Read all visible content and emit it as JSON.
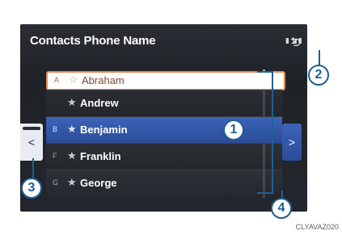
{
  "header": {
    "title": "Contacts Phone Name",
    "back_icon": "back-arrow-icon"
  },
  "status": {
    "glyphs": "▮◢▮"
  },
  "contacts": [
    {
      "index": "A",
      "name": "Abraham",
      "state": "selected"
    },
    {
      "index": "",
      "name": "Andrew",
      "state": "normal"
    },
    {
      "index": "B",
      "name": "Benjamin",
      "state": "highlight"
    },
    {
      "index": "F",
      "name": "Franklin",
      "state": "normal"
    },
    {
      "index": "G",
      "name": "George",
      "state": "normal"
    }
  ],
  "controls": {
    "left_tab": "<",
    "right_tab": ">"
  },
  "callouts": [
    "1",
    "2",
    "3",
    "4"
  ],
  "footer": {
    "code": "CLYAVAZ020"
  },
  "colors": {
    "accent": "#1f5e97",
    "selection": "#e68a52",
    "highlight": "#3c63b8"
  }
}
